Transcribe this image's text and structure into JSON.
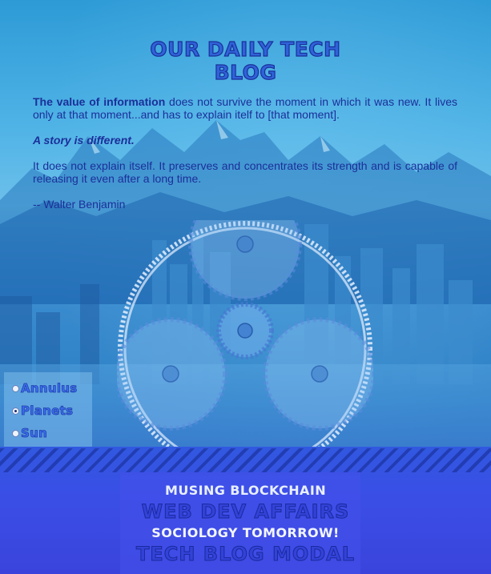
{
  "header": {
    "title": "OUR DAILY TECH BLOG"
  },
  "quote": {
    "p1_strong": "The value of information",
    "p1_rest": " does not survive the moment in which it was new. It lives only at that moment...and has to explain itelf to [that moment].",
    "p2": "A story is different.",
    "p3": "It does not explain itself. It preserves and concentrates its strength and is capable of releasing it even after a long time.",
    "attribution": "-- Walter Benjamin"
  },
  "view_options": {
    "items": [
      {
        "label": "Annulus",
        "selected": false
      },
      {
        "label": "Planets",
        "selected": true
      },
      {
        "label": "Sun",
        "selected": false
      }
    ]
  },
  "nav": {
    "links": [
      "MUSING BLOCKCHAIN",
      "WEB DEV AFFAIRS",
      "SOCIOLOGY TOMORROW!",
      "TECH BLOG MODAL"
    ]
  },
  "icons": {
    "gear_assembly": "planetary-gear-icon"
  }
}
